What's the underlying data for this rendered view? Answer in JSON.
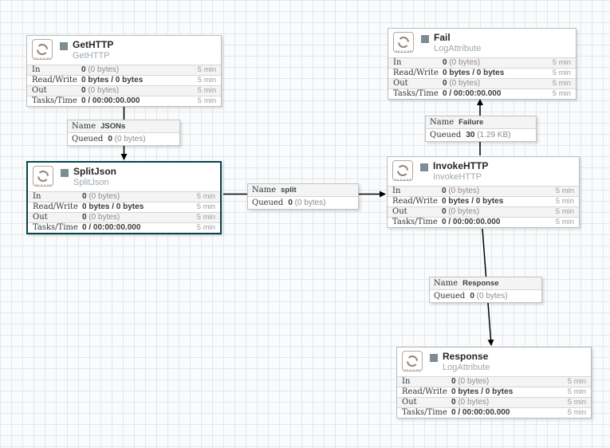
{
  "colors": {
    "canvas_bg": "#fafbfc",
    "grid_line": "#e2e8ec",
    "processor_border": "#bcbcbc",
    "selected_border": "#07454c",
    "run_status_stopped": "#7d8c92",
    "row_alt_bg": "#f4f4f4",
    "type_text": "#9aa9b1",
    "arrow": "#000000"
  },
  "connection_keys": {
    "name": "Name",
    "queued": "Queued"
  },
  "processors": [
    {
      "name": "GetHTTP",
      "type": "GetHTTP",
      "selected": false,
      "rows": [
        {
          "label": "In",
          "bold": "0",
          "rest": " (0 bytes)",
          "period": "5 min"
        },
        {
          "label": "Read/Write",
          "bold": "0 bytes / 0 bytes",
          "rest": "",
          "period": "5 min"
        },
        {
          "label": "Out",
          "bold": "0",
          "rest": " (0 bytes)",
          "period": "5 min"
        },
        {
          "label": "Tasks/Time",
          "bold": "0 / 00:00:00.000",
          "rest": "",
          "period": "5 min"
        }
      ]
    },
    {
      "name": "Fail",
      "type": "LogAttribute",
      "selected": false,
      "rows": [
        {
          "label": "In",
          "bold": "0",
          "rest": " (0 bytes)",
          "period": "5 min"
        },
        {
          "label": "Read/Write",
          "bold": "0 bytes / 0 bytes",
          "rest": "",
          "period": "5 min"
        },
        {
          "label": "Out",
          "bold": "0",
          "rest": " (0 bytes)",
          "period": "5 min"
        },
        {
          "label": "Tasks/Time",
          "bold": "0 / 00:00:00.000",
          "rest": "",
          "period": "5 min"
        }
      ]
    },
    {
      "name": "SplitJson",
      "type": "SplitJson",
      "selected": true,
      "rows": [
        {
          "label": "In",
          "bold": "0",
          "rest": " (0 bytes)",
          "period": "5 min"
        },
        {
          "label": "Read/Write",
          "bold": "0 bytes / 0 bytes",
          "rest": "",
          "period": "5 min"
        },
        {
          "label": "Out",
          "bold": "0",
          "rest": " (0 bytes)",
          "period": "5 min"
        },
        {
          "label": "Tasks/Time",
          "bold": "0 / 00:00:00.000",
          "rest": "",
          "period": "5 min"
        }
      ]
    },
    {
      "name": "InvokeHTTP",
      "type": "InvokeHTTP",
      "selected": false,
      "rows": [
        {
          "label": "In",
          "bold": "0",
          "rest": " (0 bytes)",
          "period": "5 min"
        },
        {
          "label": "Read/Write",
          "bold": "0 bytes / 0 bytes",
          "rest": "",
          "period": "5 min"
        },
        {
          "label": "Out",
          "bold": "0",
          "rest": " (0 bytes)",
          "period": "5 min"
        },
        {
          "label": "Tasks/Time",
          "bold": "0 / 00:00:00.000",
          "rest": "",
          "period": "5 min"
        }
      ]
    },
    {
      "name": "Response",
      "type": "LogAttribute",
      "selected": false,
      "rows": [
        {
          "label": "In",
          "bold": "0",
          "rest": " (0 bytes)",
          "period": "5 min"
        },
        {
          "label": "Read/Write",
          "bold": "0 bytes / 0 bytes",
          "rest": "",
          "period": "5 min"
        },
        {
          "label": "Out",
          "bold": "0",
          "rest": " (0 bytes)",
          "period": "5 min"
        },
        {
          "label": "Tasks/Time",
          "bold": "0 / 00:00:00.000",
          "rest": "",
          "period": "5 min"
        }
      ]
    }
  ],
  "connections": [
    {
      "name": "JSONs",
      "queued_bold": "0",
      "queued_rest": " (0 bytes)"
    },
    {
      "name": "Failure",
      "queued_bold": "30",
      "queued_rest": " (1.29 KB)"
    },
    {
      "name": "split",
      "queued_bold": "0",
      "queued_rest": " (0 bytes)"
    },
    {
      "name": "Response",
      "queued_bold": "0",
      "queued_rest": " (0 bytes)"
    }
  ]
}
